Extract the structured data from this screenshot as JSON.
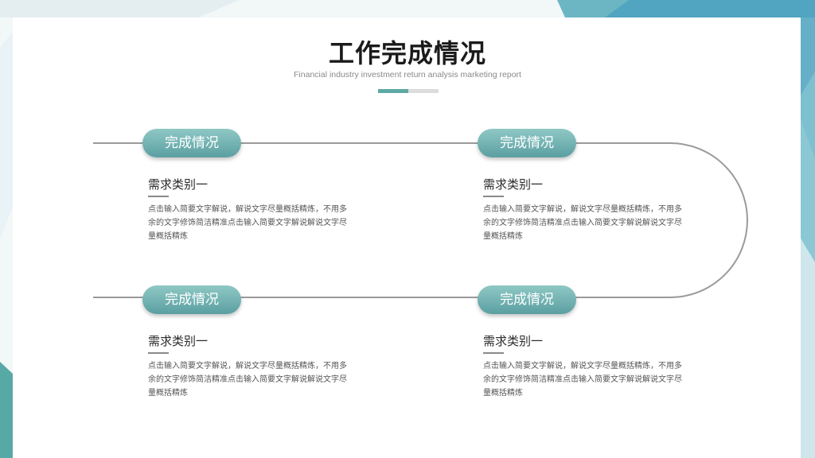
{
  "header": {
    "title": "工作完成情况",
    "subtitle": "Financial industry investment return analysis marketing report"
  },
  "items": [
    {
      "badge": "完成情况",
      "title": "需求类别一",
      "desc": "点击输入简要文字解说，解说文字尽量概括精炼，不用多余的文字修饰简洁精准点击输入简要文字解说解说文字尽量概括精炼"
    },
    {
      "badge": "完成情况",
      "title": "需求类别一",
      "desc": "点击输入简要文字解说，解说文字尽量概括精炼，不用多余的文字修饰简洁精准点击输入简要文字解说解说文字尽量概括精炼"
    },
    {
      "badge": "完成情况",
      "title": "需求类别一",
      "desc": "点击输入简要文字解说，解说文字尽量概括精炼，不用多余的文字修饰简洁精准点击输入简要文字解说解说文字尽量概括精炼"
    },
    {
      "badge": "完成情况",
      "title": "需求类别一",
      "desc": "点击输入简要文字解说，解说文字尽量概括精炼，不用多余的文字修饰简洁精准点击输入简要文字解说解说文字尽量概括精炼"
    }
  ],
  "colors": {
    "accent": "#5fa9a4",
    "pill_top": "#8ec8c4",
    "pill_bottom": "#5b9fa2",
    "line": "#9a9a9a"
  }
}
